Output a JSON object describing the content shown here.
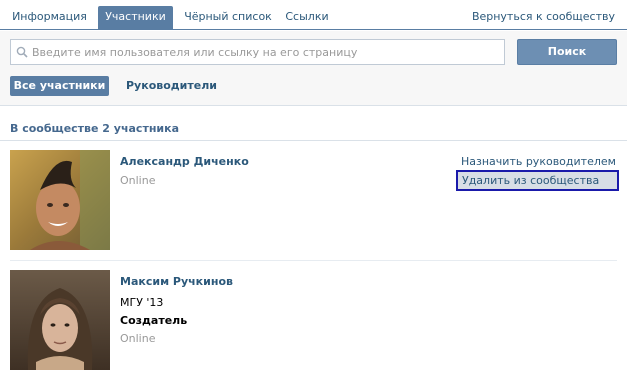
{
  "tabs": [
    {
      "label": "Информация",
      "active": false
    },
    {
      "label": "Участники",
      "active": true
    },
    {
      "label": "Чёрный список",
      "active": false
    },
    {
      "label": "Ссылки",
      "active": false
    }
  ],
  "back_link": "Вернуться к сообществу",
  "search": {
    "placeholder": "Введите имя пользователя или ссылку на его страницу",
    "value": "",
    "button_label": "Поиск"
  },
  "filters": {
    "all_label": "Все участники",
    "leaders_label": "Руководители"
  },
  "count_text": "В сообществе 2 участника",
  "members": [
    {
      "name": "Александр Диченко",
      "status": "Online",
      "actions": {
        "promote": "Назначить руководителем",
        "remove": "Удалить из сообщества"
      }
    },
    {
      "name": "Максим Ручкинов",
      "university": "МГУ '13",
      "role": "Создатель",
      "status": "Online"
    }
  ],
  "colors": {
    "accent": "#597da3",
    "link": "#2b587a",
    "highlight_border": "#1a1aaa"
  }
}
